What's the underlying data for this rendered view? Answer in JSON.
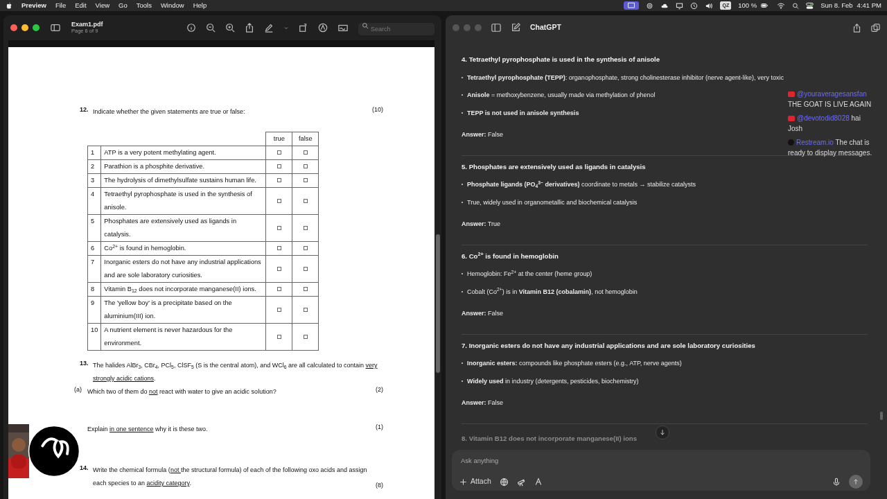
{
  "menubar": {
    "app": "Preview",
    "menus": [
      "File",
      "Edit",
      "View",
      "Go",
      "Tools",
      "Window",
      "Help"
    ],
    "keyboard": "QZ",
    "battery": "100 %",
    "date": "Sun 8. Feb",
    "time": "4:41 PM"
  },
  "preview": {
    "title": "Exam1.pdf",
    "subtitle": "Page 6 of 9",
    "search_placeholder": "Search",
    "q12": {
      "number": "12.",
      "text": "Indicate whether the given statements are true or false:",
      "points": "(10)",
      "columns": [
        "true",
        "false"
      ],
      "rows": [
        {
          "number": "1",
          "text": "ATP is a very potent methylating agent.",
          "true_checked": false,
          "false_checked": false
        },
        {
          "number": "2",
          "text": "Parathion is a phosphite derivative.",
          "true_checked": false,
          "false_checked": false
        },
        {
          "number": "3",
          "text": "The hydrolysis of dimethylsulfate sustains human life.",
          "true_checked": false,
          "false_checked": false
        },
        {
          "number": "4",
          "text": "Tetraethyl pyrophosphate is used in the synthesis of anisole.",
          "true_checked": false,
          "false_checked": false
        },
        {
          "number": "5",
          "text": "Phosphates are extensively used as ligands in catalysis.",
          "true_checked": false,
          "false_checked": false
        },
        {
          "number": "6",
          "text": "Co$^{2+}$ is found in hemoglobin.",
          "true_checked": false,
          "false_checked": false
        },
        {
          "number": "7",
          "text": "Inorganic esters do not have any industrial applications and are sole laboratory curiosities.",
          "true_checked": false,
          "false_checked": false
        },
        {
          "number": "8",
          "text": "Vitamin B$_{12}$ does not incorporate manganese(II) ions.",
          "true_checked": false,
          "false_checked": false
        },
        {
          "number": "9",
          "text": "The 'yellow boy' is a precipitate based on the aluminium(III) ion.",
          "true_checked": false,
          "false_checked": false
        },
        {
          "number": "10",
          "text": "A nutrient element is never hazardous for the environment.",
          "true_checked": false,
          "false_checked": false
        }
      ]
    },
    "q13": {
      "number": "13.",
      "parts": [
        {
          "text": "The halides AlBr$_{3}$, CBr$_{4}$, PCl$_{5}$, ClSF$_{5}$ (S is the central atom), and WCl$_{6}$ are all calculated to contain ",
          "underline": false
        },
        {
          "text": "very strongly acidic cations",
          "underline": true
        },
        {
          "text": ".",
          "underline": false
        }
      ],
      "subs": [
        {
          "label": "(a)",
          "parts": [
            {
              "text": "Which two of them do ",
              "underline": false
            },
            {
              "text": "not",
              "underline": true
            },
            {
              "text": " react with water to give an acidic solution?",
              "underline": false
            }
          ],
          "points": "(2)"
        },
        {
          "parts": [
            {
              "text": "Explain ",
              "underline": false
            },
            {
              "text": "in one sentence",
              "underline": true
            },
            {
              "text": " why it is these two.",
              "underline": false
            }
          ],
          "points": "(1)"
        }
      ]
    },
    "q14": {
      "number": "14.",
      "parts": [
        {
          "text": "Write the chemical formula (",
          "underline": false
        },
        {
          "text": "not ",
          "underline": true
        },
        {
          "text": "the structural formula) of each of the following oxo acids and assign each species to an ",
          "underline": false
        },
        {
          "text": "acidity category",
          "underline": true
        },
        {
          "text": ".",
          "underline": false
        }
      ],
      "points": "(8)"
    }
  },
  "chat": {
    "title": "ChatGPT",
    "sections": [
      {
        "heading": "4. Tetraethyl pyrophosphate is used in the synthesis of anisole",
        "bullets": [
          "**Tetraethyl pyrophosphate (TEPP)**: organophosphate, strong cholinesterase inhibitor (nerve agent-like), very toxic",
          "**Anisole** = methoxybenzene, usually made via methylation of phenol",
          "**TEPP is not used in anisole synthesis**"
        ],
        "answer": "**Answer:** False"
      },
      {
        "heading": "5. Phosphates are extensively used as ligands in catalysis",
        "bullets": [
          "**Phosphate ligands (PO$_{4}$$^{3−}$ derivatives)** coordinate to metals → stabilize catalysts",
          "True, widely used in organometallic and biochemical catalysis"
        ],
        "answer": "**Answer:** True"
      },
      {
        "heading": "6. Co$^{2+}$ is found in hemoglobin",
        "bullets": [
          "Hemoglobin: Fe$^{2+}$ at the center (heme group)",
          "Cobalt (Co$^{2+}$) is in **Vitamin B12 (cobalamin)**, not hemoglobin"
        ],
        "answer": "**Answer:** False"
      },
      {
        "heading": "7. Inorganic esters do not have any industrial applications and are sole laboratory curiosities",
        "bullets": [
          "**Inorganic esters:** compounds like phosphate esters (e.g., ATP, nerve agents)",
          "**Widely used** in industry (detergents, pesticides, biochemistry)"
        ],
        "answer": "**Answer:** False"
      }
    ],
    "faded_heading": "8. Vitamin B12 does not incorporate manganese(II) ions",
    "composer": {
      "placeholder": "Ask anything",
      "attach": "Attach"
    }
  },
  "stream_chat": [
    {
      "kind": "youtube",
      "user": "@youraveragesansfan",
      "message": "THE GOAT IS LIVE AGAIN"
    },
    {
      "kind": "youtube",
      "user": "@devotodid8028",
      "message": "hai Josh"
    },
    {
      "kind": "restream",
      "user": "Restream.io",
      "message": "The chat is ready to display messages."
    }
  ]
}
